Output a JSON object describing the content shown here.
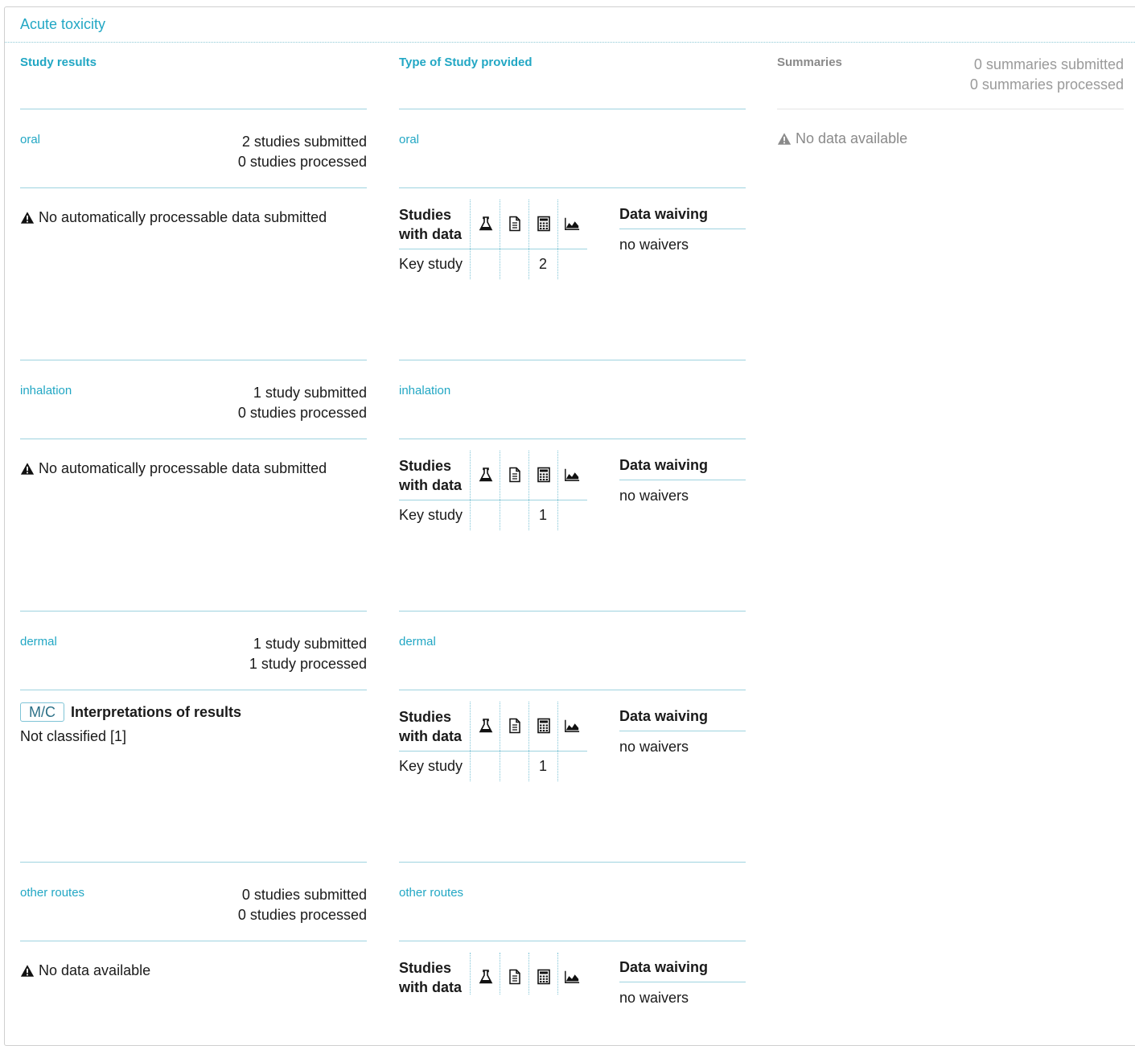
{
  "title": "Acute toxicity",
  "headers": {
    "study_results": "Study results",
    "type_of_study": "Type of Study provided",
    "summaries": "Summaries"
  },
  "summaries": {
    "submitted": "0 summaries submitted",
    "processed": "0 summaries processed",
    "message": "No data available"
  },
  "routes": [
    {
      "name": "oral",
      "submitted": "2 studies submitted",
      "processed": "0 studies processed",
      "result_message": "No automatically processable data submitted",
      "studies_header": "Studies with data",
      "key_study_label": "Key study",
      "key_study_count": "2",
      "waiving_title": "Data waiving",
      "waiving_value": "no waivers"
    },
    {
      "name": "inhalation",
      "submitted": "1 study submitted",
      "processed": "0 studies processed",
      "result_message": "No automatically processable data submitted",
      "studies_header": "Studies with data",
      "key_study_label": "Key study",
      "key_study_count": "1",
      "waiving_title": "Data waiving",
      "waiving_value": "no waivers"
    },
    {
      "name": "dermal",
      "submitted": "1 study submitted",
      "processed": "1 study processed",
      "badge": "M/C",
      "interpretation_title": "Interpretations of results",
      "classification": "Not classified [1]",
      "studies_header": "Studies with data",
      "key_study_label": "Key study",
      "key_study_count": "1",
      "waiving_title": "Data waiving",
      "waiving_value": "no waivers"
    },
    {
      "name": "other routes",
      "submitted": "0 studies submitted",
      "processed": "0 studies processed",
      "result_message": "No data available",
      "studies_header": "Studies with data",
      "waiving_title": "Data waiving",
      "waiving_value": "no waivers"
    }
  ],
  "icons": [
    "flask-icon",
    "document-icon",
    "calculator-icon",
    "area-chart-icon",
    "warning-icon"
  ],
  "colors": {
    "accent": "#22a7c4",
    "rule": "#9ed3df",
    "muted": "#8a8a8a"
  }
}
